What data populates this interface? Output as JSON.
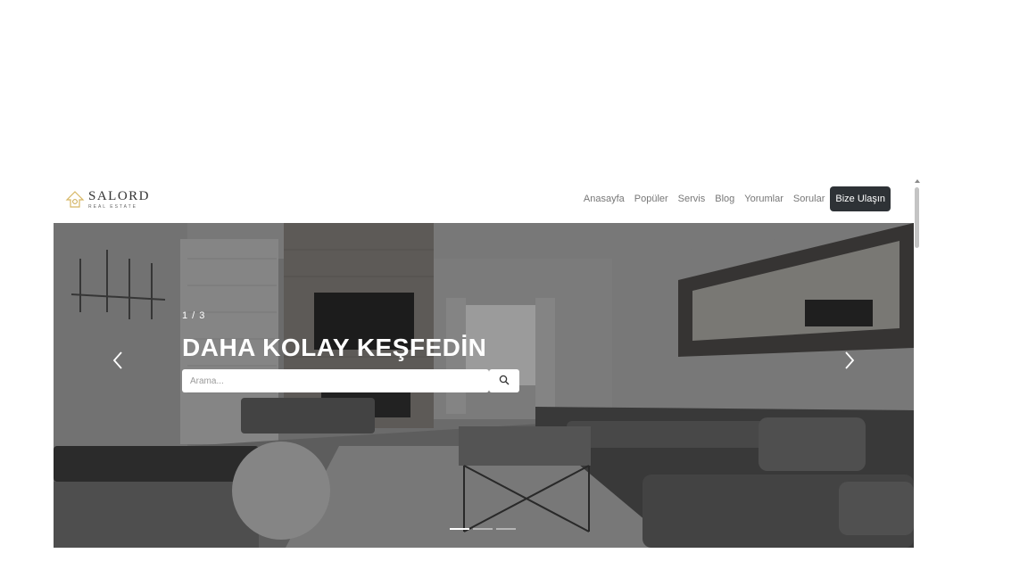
{
  "brand": {
    "name": "SALORD",
    "tagline": "REAL ESTATE",
    "accent_color": "#c9a64a"
  },
  "nav": {
    "links": [
      "Anasayfa",
      "Popüler",
      "Servis",
      "Blog",
      "Yorumlar",
      "Sorular"
    ],
    "cta_label": "Bize Ulaşın",
    "cta_color": "#2e3236"
  },
  "hero": {
    "counter": "1 / 3",
    "title": "DAHA KOLAY KEŞFEDİN",
    "search_placeholder": "Arama...",
    "active_slide": 1,
    "slide_count": 3,
    "icons": {
      "prev": "chevron-left-icon",
      "next": "chevron-right-icon",
      "search": "search-icon"
    }
  }
}
